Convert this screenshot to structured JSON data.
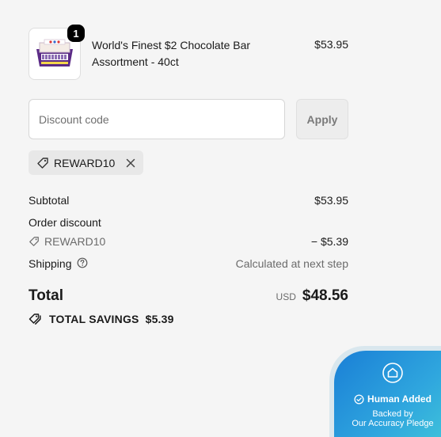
{
  "product": {
    "quantity": "1",
    "title": "World's Finest $2 Chocolate Bar Assortment - 40ct",
    "price": "$53.95",
    "image_icon": "chocolate-box-icon"
  },
  "discount": {
    "placeholder": "Discount code",
    "apply_label": "Apply",
    "applied_code": "REWARD10"
  },
  "summary": {
    "subtotal_label": "Subtotal",
    "subtotal_value": "$53.95",
    "order_discount_label": "Order discount",
    "discount_code": "REWARD10",
    "discount_value": "− $5.39",
    "shipping_label": "Shipping",
    "shipping_value": "Calculated at next step",
    "total_label": "Total",
    "currency": "USD",
    "total_value": "$48.56",
    "savings_label": "TOTAL SAVINGS",
    "savings_value": "$5.39"
  },
  "trust_badge": {
    "title": "Human Added",
    "line1": "Backed by",
    "line2": "Our Accuracy Pledge"
  }
}
